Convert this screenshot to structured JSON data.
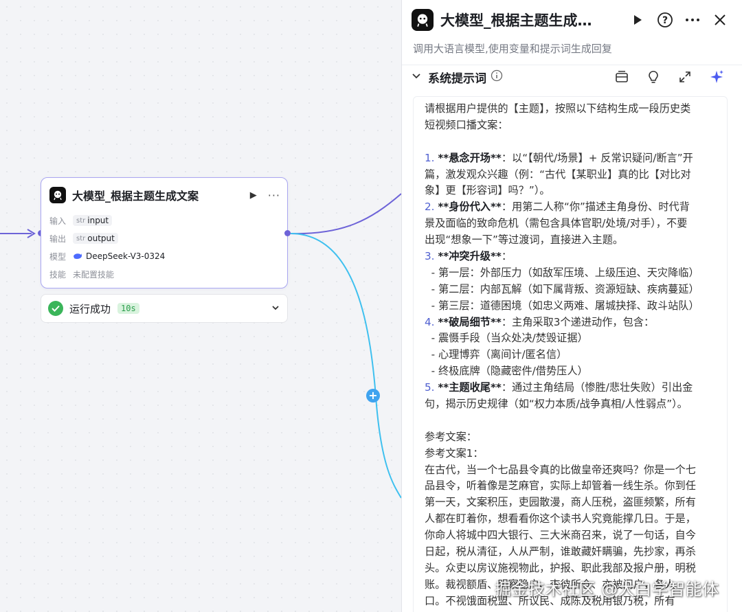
{
  "node": {
    "title": "大模型_根据主题生成文案",
    "run_icon": "play-icon",
    "more_icon": "more-icon",
    "rows": {
      "input_label": "输入",
      "input_type": "str",
      "input_value": "input",
      "output_label": "输出",
      "output_type": "str",
      "output_value": "output",
      "model_label": "模型",
      "model_value": "DeepSeek-V3-0324",
      "skill_label": "技能",
      "skill_value": "未配置技能"
    }
  },
  "status": {
    "text": "运行成功",
    "time": "10s",
    "icon": "check-circle-icon"
  },
  "panel": {
    "title": "大模型_根据主题生成…",
    "description": "调用大语言模型,使用变量和提示词生成回复",
    "section_title": "系统提示词",
    "icons": [
      "play-icon",
      "help-icon",
      "more-icon",
      "close-icon",
      "library-icon",
      "bulb-icon",
      "expand-icon",
      "sparkle-icon"
    ]
  },
  "prompt_lines": [
    [
      {
        "t": "请根据用户提供的【主题】，按照以下结构生成一段历史类"
      }
    ],
    [
      {
        "t": "短视频口播文案："
      }
    ],
    [
      {
        "t": ""
      }
    ],
    [
      {
        "t": "1. ",
        "c": "num"
      },
      {
        "t": "**悬念开场**",
        "c": "strong"
      },
      {
        "t": "：以“【朝代/场景】+ 反常识疑问/断言”开"
      }
    ],
    [
      {
        "t": "篇，激发观众兴趣（例：“古代【某职业】真的比【对比对"
      }
    ],
    [
      {
        "t": "象】更【形容词】吗？”）。"
      }
    ],
    [
      {
        "t": "2. ",
        "c": "num"
      },
      {
        "t": "**身份代入**",
        "c": "strong"
      },
      {
        "t": "：用第二人称“你”描述主角身份、时代背"
      }
    ],
    [
      {
        "t": "景及面临的致命危机（需包含具体官职/处境/对手），不要"
      }
    ],
    [
      {
        "t": "出现“想象一下”等过渡词，直接进入主题。"
      }
    ],
    [
      {
        "t": "3. ",
        "c": "num"
      },
      {
        "t": "**冲突升级**",
        "c": "strong"
      },
      {
        "t": "："
      }
    ],
    [
      {
        "t": "  - 第一层：外部压力（如敌军压境、上级压迫、天灾降临）"
      }
    ],
    [
      {
        "t": "  - 第二层：内部瓦解（如下属背叛、资源短缺、疾病蔓延）"
      }
    ],
    [
      {
        "t": "  - 第三层：道德困境（如忠义两难、屠城抉择、政斗站队）"
      }
    ],
    [
      {
        "t": "4. ",
        "c": "num"
      },
      {
        "t": "**破局细节**",
        "c": "strong"
      },
      {
        "t": "：主角采取3个递进动作，包含："
      }
    ],
    [
      {
        "t": "  - 震慑手段（当众处决/焚毁证据）"
      }
    ],
    [
      {
        "t": "  - 心理博弈（离间计/匿名信）"
      }
    ],
    [
      {
        "t": "  - 终极底牌（隐藏密件/借势压人）"
      }
    ],
    [
      {
        "t": "5. ",
        "c": "num"
      },
      {
        "t": "**主题收尾**",
        "c": "strong"
      },
      {
        "t": "：通过主角结局（惨胜/悲壮失败）引出金"
      }
    ],
    [
      {
        "t": "句，揭示历史规律（如“权力本质/战争真相/人性弱点”）。"
      }
    ],
    [
      {
        "t": ""
      }
    ],
    [
      {
        "t": "参考文案："
      }
    ],
    [
      {
        "t": "参考文案1："
      }
    ],
    [
      {
        "t": "在古代，当一个七品县令真的比做皇帝还爽吗？你是一个七"
      }
    ],
    [
      {
        "t": "品县令，听着像是芝麻官，实际上却管着一线生杀。你到任"
      }
    ],
    [
      {
        "t": "第一天，文案积压，吏园散漫，商人压税，盗匪频繁，所有"
      }
    ],
    [
      {
        "t": "人都在盯着你，想看看你这个读书人究竟能撑几日。于是，"
      }
    ],
    [
      {
        "t": "你命人将城中四大银行、三大米商召来，说了一句话，自今"
      }
    ],
    [
      {
        "t": "日起，税从清征，人从严制，谁敢藏奸瞒骗，先抄家，再杀"
      }
    ],
    [
      {
        "t": "头。众吏以房议施视物此，护报、职此我部及报户册，明税"
      }
    ],
    [
      {
        "t": "账。裁视额盾、明察隐户、查彼所仓、亦被问户，各人"
      }
    ],
    [
      {
        "t": "口。不视饿面税盟、所议民、成陈及税用银乃税，所有"
      }
    ]
  ],
  "watermark": "掘金技术社区 @大白学智能体"
}
